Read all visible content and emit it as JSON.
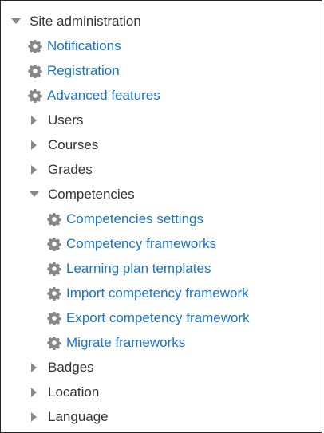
{
  "tree": {
    "root": {
      "label": "Site administration",
      "icon": "caret-down-icon"
    },
    "items": [
      {
        "label": "Notifications",
        "icon": "gear-icon"
      },
      {
        "label": "Registration",
        "icon": "gear-icon"
      },
      {
        "label": "Advanced features",
        "icon": "gear-icon"
      },
      {
        "label": "Users",
        "icon": "caret-right-icon"
      },
      {
        "label": "Courses",
        "icon": "caret-right-icon"
      },
      {
        "label": "Grades",
        "icon": "caret-right-icon"
      },
      {
        "label": "Competencies",
        "icon": "caret-down-icon"
      },
      {
        "label": "Competencies settings",
        "icon": "gear-icon"
      },
      {
        "label": "Competency frameworks",
        "icon": "gear-icon"
      },
      {
        "label": "Learning plan templates",
        "icon": "gear-icon"
      },
      {
        "label": "Import competency framework",
        "icon": "gear-icon"
      },
      {
        "label": "Export competency framework",
        "icon": "gear-icon"
      },
      {
        "label": "Migrate frameworks",
        "icon": "gear-icon"
      },
      {
        "label": "Badges",
        "icon": "caret-right-icon"
      },
      {
        "label": "Location",
        "icon": "caret-right-icon"
      },
      {
        "label": "Language",
        "icon": "caret-right-icon"
      }
    ]
  },
  "colors": {
    "link": "#1a73c4",
    "text": "#333333",
    "icon": "#888888",
    "border": "#222222"
  }
}
